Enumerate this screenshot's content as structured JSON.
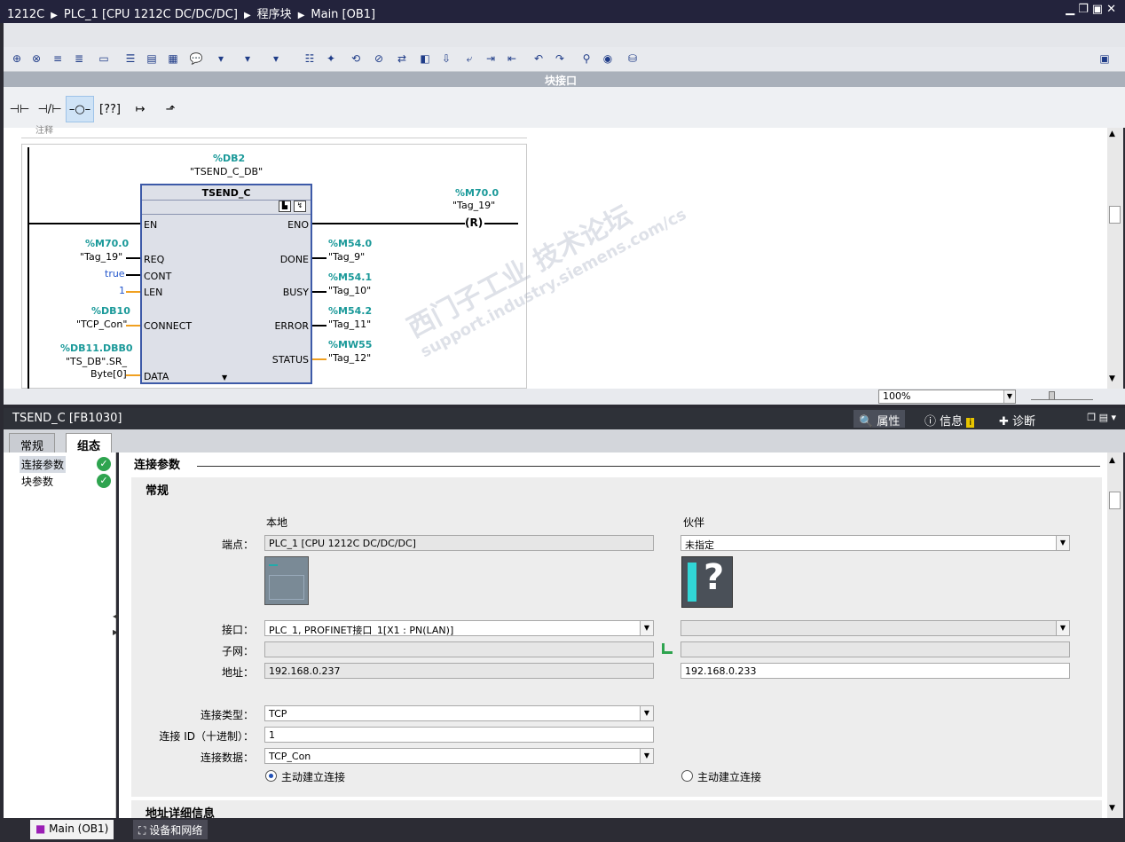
{
  "titlebar": {
    "crumbs": [
      "1212C",
      "PLC_1 [CPU 1212C DC/DC/DC]",
      "程序块",
      "Main [OB1]"
    ]
  },
  "interface_bar": {
    "label": "块接口"
  },
  "network": {
    "comment_label": "注释",
    "instance_db": {
      "address": "%DB2",
      "name": "\"TSEND_C_DB\""
    },
    "block": {
      "title": "TSEND_C",
      "inputs": [
        "EN",
        "REQ",
        "CONT",
        "LEN",
        "CONNECT",
        "DATA"
      ],
      "outputs": [
        "ENO",
        "DONE",
        "BUSY",
        "ERROR",
        "STATUS"
      ]
    },
    "coil": {
      "address": "%M70.0",
      "name": "\"Tag_19\"",
      "symbol": "R"
    },
    "input_operands": {
      "req_addr": "%M70.0",
      "req_name": "\"Tag_19\"",
      "cont_value": "true",
      "len_value": "1",
      "connect_addr": "%DB10",
      "connect_name": "\"TCP_Con\"",
      "data_addr": "%DB11.DBB0",
      "data_name1": "\"TS_DB\".SR_",
      "data_name2": "Byte[0]"
    },
    "output_operands": {
      "done_addr": "%M54.0",
      "done_name": "\"Tag_9\"",
      "busy_addr": "%M54.1",
      "busy_name": "\"Tag_10\"",
      "error_addr": "%M54.2",
      "error_name": "\"Tag_11\"",
      "status_addr": "%MW55",
      "status_name": "\"Tag_12\""
    }
  },
  "zoom": {
    "value": "100%"
  },
  "inspector": {
    "title": "TSEND_C [FB1030]",
    "tabs": [
      "属性",
      "信息",
      "诊断"
    ],
    "subtabs": [
      "常规",
      "组态"
    ],
    "nav": [
      "连接参数",
      "块参数"
    ],
    "section_title": "连接参数",
    "group_title": "常规",
    "col_local": "本地",
    "col_partner": "伙伴",
    "labels": {
      "endpoint": "端点：",
      "interface": "接口：",
      "subnet": "子网：",
      "address": "地址：",
      "conn_type": "连接类型：",
      "conn_id": "连接 ID（十进制）：",
      "conn_data": "连接数据："
    },
    "local": {
      "endpoint": "PLC_1 [CPU 1212C DC/DC/DC]",
      "interface": "PLC_1, PROFINET接口_1[X1 : PN(LAN)]",
      "subnet": "",
      "address": "192.168.0.237",
      "conn_type": "TCP",
      "conn_id": "1",
      "conn_data": "TCP_Con",
      "active_label": "主动建立连接",
      "active_checked": true
    },
    "partner": {
      "endpoint": "未指定",
      "interface": "",
      "subnet": "",
      "address": "192.168.0.233",
      "active_label": "主动建立连接",
      "active_checked": false
    },
    "next_section": "地址详细信息"
  },
  "taskbar": {
    "items": [
      "Main (OB1)",
      "设备和网络"
    ]
  },
  "watermark": {
    "line1": "西门子工业  技术论坛",
    "line2": "support.industry.siemens.com/cs"
  },
  "colors": {
    "titlebar": "#23233c",
    "teal_address": "#1a9999",
    "ok_green": "#2ea44f"
  }
}
